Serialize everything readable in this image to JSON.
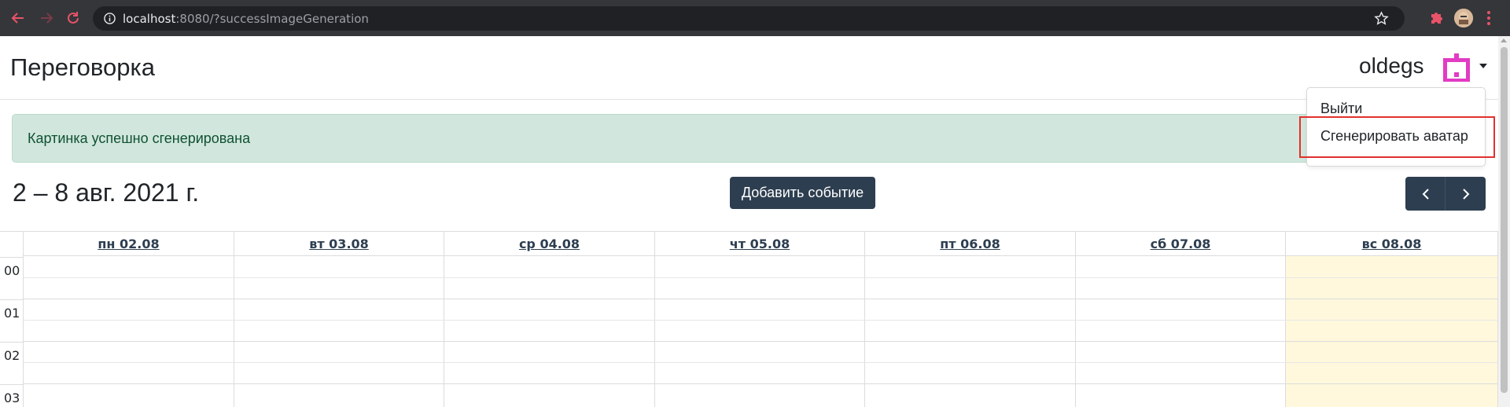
{
  "browser": {
    "url_host": "localhost",
    "url_rest": ":8080/?successImageGeneration"
  },
  "navbar": {
    "brand": "Переговорка",
    "username": "oldegs",
    "avatar_color": "#e23bc4"
  },
  "dropdown": {
    "items": [
      "Выйти",
      "Сгенерировать аватар"
    ]
  },
  "alert": {
    "text": "Картинка успешно сгенерирована"
  },
  "calendar": {
    "week_title": "2 – 8 авг. 2021 г.",
    "add_event_label": "Добавить событие",
    "days": [
      "пн 02.08",
      "вт 03.08",
      "ср 04.08",
      "чт 05.08",
      "пт 06.08",
      "сб 07.08",
      "вс 08.08"
    ],
    "today_index": 6,
    "hours": [
      "00",
      "01",
      "02",
      "03"
    ]
  },
  "colors": {
    "accent": "#2d3e50",
    "alert_bg": "#d1e7dd",
    "alert_text": "#0f5132",
    "today_bg": "#fff8dc",
    "highlight": "#e0322e"
  }
}
